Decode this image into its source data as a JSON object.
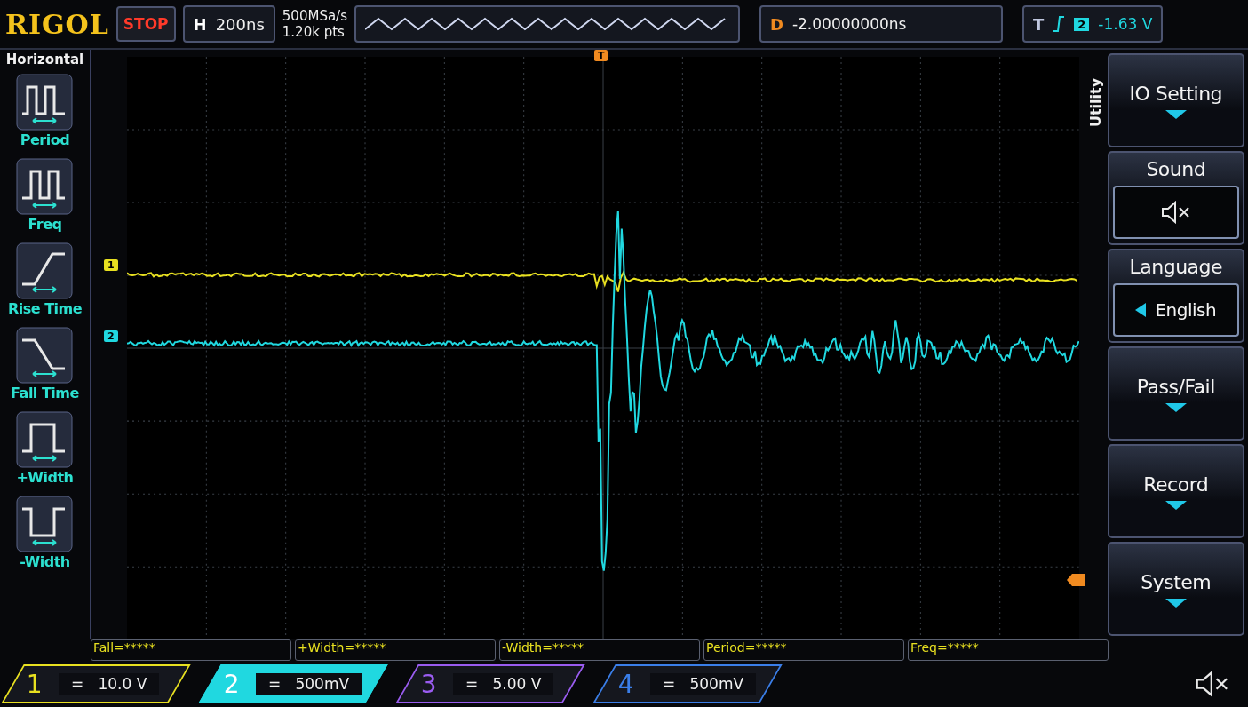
{
  "header": {
    "brand": "RIGOL",
    "run_state": "STOP",
    "timebase_label": "H",
    "timebase": "200ns",
    "sample_rate": "500MSa/s",
    "memory_depth": "1.20k pts",
    "delay_label": "D",
    "delay": "-2.00000000ns",
    "trigger_label": "T",
    "trigger_source": "2",
    "trigger_level": "-1.63 V"
  },
  "sidebar": {
    "title": "Horizontal",
    "items": [
      {
        "kind": "period",
        "label": "Period"
      },
      {
        "kind": "freq",
        "label": "Freq"
      },
      {
        "kind": "rise",
        "label": "Rise Time"
      },
      {
        "kind": "fall",
        "label": "Fall Time"
      },
      {
        "kind": "pwidth",
        "label": "+Width"
      },
      {
        "kind": "nwidth",
        "label": "-Width"
      }
    ]
  },
  "plot": {
    "trigger_marker": "T",
    "channel_markers": [
      {
        "label": "1",
        "color": "#e8e020"
      },
      {
        "label": "2",
        "color": "#20d8e0"
      }
    ]
  },
  "menu": {
    "title": "Utility",
    "items": [
      {
        "kind": "submenu",
        "label": "IO Setting"
      },
      {
        "kind": "sound",
        "label": "Sound",
        "muted": true
      },
      {
        "kind": "value",
        "label": "Language",
        "value": "English"
      },
      {
        "kind": "submenu",
        "label": "Pass/Fail"
      },
      {
        "kind": "submenu",
        "label": "Record"
      },
      {
        "kind": "submenu",
        "label": "System"
      }
    ]
  },
  "measurements": [
    "Fall=*****",
    "+Width=*****",
    "-Width=*****",
    "Period=*****",
    "Freq=*****"
  ],
  "channels": [
    {
      "number": "1",
      "symbol": "=",
      "scale": "10.0 V",
      "color": "#e8e020",
      "selected": false
    },
    {
      "number": "2",
      "symbol": "=",
      "scale": "500mV",
      "color": "#20d8e0",
      "selected": true
    },
    {
      "number": "3",
      "symbol": "=",
      "scale": "5.00 V",
      "color": "#9a5cf0",
      "selected": false
    },
    {
      "number": "4",
      "symbol": "=",
      "scale": "500mV",
      "color": "#3a7ee8",
      "selected": false
    }
  ]
}
